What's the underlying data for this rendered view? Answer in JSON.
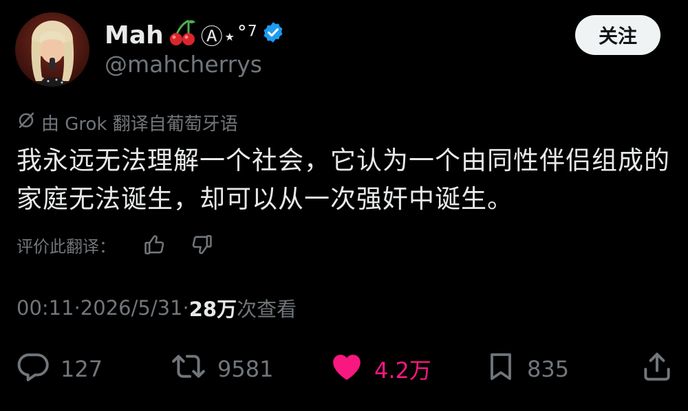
{
  "header": {
    "display_name": "Mah",
    "name_suffix": "Ⓐ⋆˚",
    "name_suffix_sup": "7",
    "handle": "@mahcherrys",
    "follow_label": "关注"
  },
  "translation": {
    "note": "由 Grok 翻译自葡萄牙语",
    "rate_label": "评价此翻译："
  },
  "tweet": {
    "text": "我永远无法理解一个社会，它认为一个由同性伴侣组成的家庭无法诞生，却可以从一次强奸中诞生。"
  },
  "meta": {
    "time": "00:11",
    "separator": " · ",
    "date": "2026/5/31",
    "views_count": "28万",
    "views_label": " 次查看"
  },
  "actions": {
    "replies": "127",
    "reposts": "9581",
    "likes": "4.2万",
    "bookmarks": "835"
  },
  "colors": {
    "background": "#000000",
    "text": "#e7e9ea",
    "muted": "#71767b",
    "like": "#f91880",
    "verified": "#1d9bf0",
    "follow_bg": "#eff3f4"
  },
  "icons": {
    "cherry": "cherry-icon",
    "verified": "verified-badge-icon",
    "translate": "translate-slash-icon",
    "thumbs_up": "thumbs-up-icon",
    "thumbs_down": "thumbs-down-icon",
    "reply": "reply-icon",
    "repost": "repost-icon",
    "like": "heart-icon",
    "bookmark": "bookmark-icon",
    "share": "share-icon"
  }
}
